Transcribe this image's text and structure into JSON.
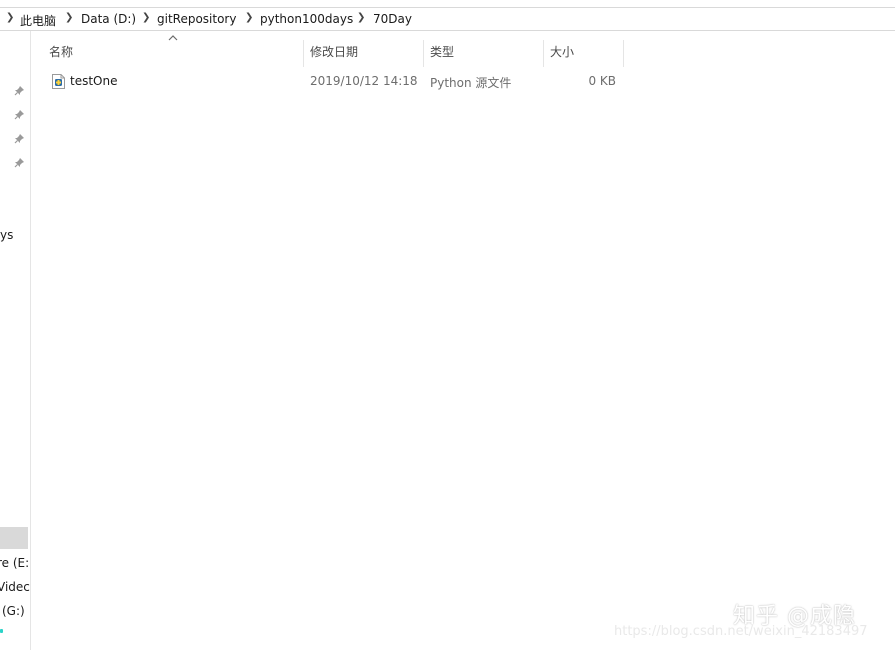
{
  "breadcrumb": {
    "items": [
      "此电脑",
      "Data (D:)",
      "gitRepository",
      "python100days",
      "70Day"
    ]
  },
  "nav": {
    "items": [
      {
        "label": "ys"
      },
      {
        "label": "re (E:"
      },
      {
        "label": "Videc"
      },
      {
        "label": "(G:)"
      }
    ]
  },
  "columns": {
    "name": "名称",
    "modified": "修改日期",
    "type": "类型",
    "size": "大小"
  },
  "files": [
    {
      "name": "testOne",
      "modified": "2019/10/12 14:18",
      "type": "Python 源文件",
      "size": "0 KB"
    }
  ],
  "watermark": {
    "zhihu": "知乎 @成隐",
    "csdn": "https://blog.csdn.net/weixin_42183497"
  },
  "colors": {
    "selection": "#d9d9d9",
    "border": "#e5e5e5",
    "python_icon": "#2e6da4"
  }
}
